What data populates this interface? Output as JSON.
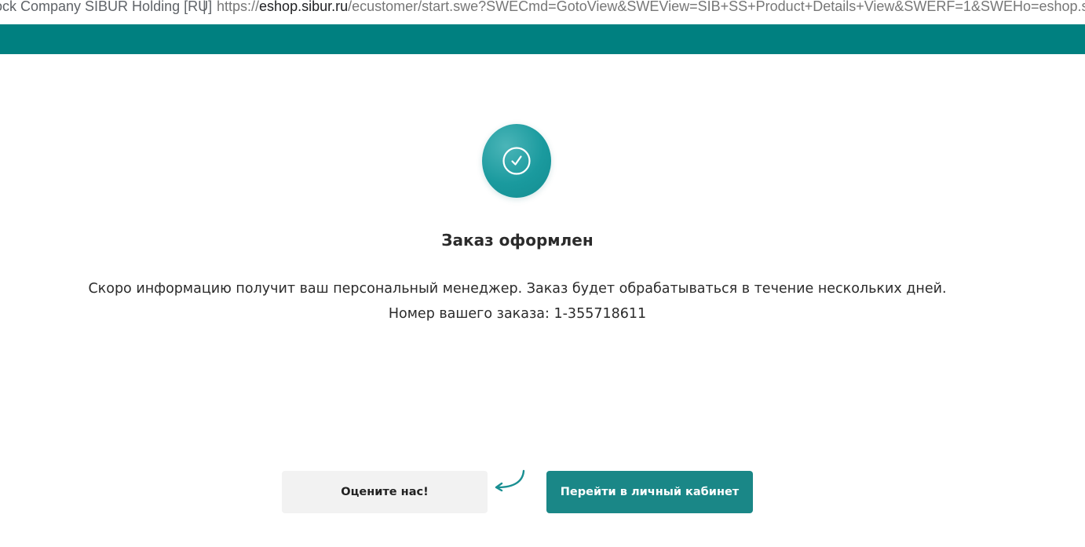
{
  "browser": {
    "tab_site_name": "ock Company SIBUR Holding [RU]",
    "separator": "|",
    "url_prefix": "https://",
    "url_host": "eshop.sibur.ru",
    "url_path": "/ecustomer/start.swe?SWECmd=GotoView&SWEView=SIB+SS+Product+Details+View&SWERF=1&SWEHo=eshop.sibur.ru"
  },
  "header": {
    "color": "#008080"
  },
  "status": {
    "icon": "check-circle-icon",
    "title": "Заказ оформлен",
    "message": "Скоро информацию получит ваш персональный менеджер. Заказ будет обрабатываться в течение нескольких дней.",
    "order_label": "Номер вашего заказа:",
    "order_number": "1-355718611"
  },
  "actions": {
    "rate_label": "Оцените нас!",
    "cabinet_label": "Перейти в личный кабинет",
    "hint_icon": "curved-arrow-icon"
  },
  "colors": {
    "accent": "#1a8787",
    "badge": "#1a9a9e",
    "secondary_button": "#f2f2f2"
  }
}
